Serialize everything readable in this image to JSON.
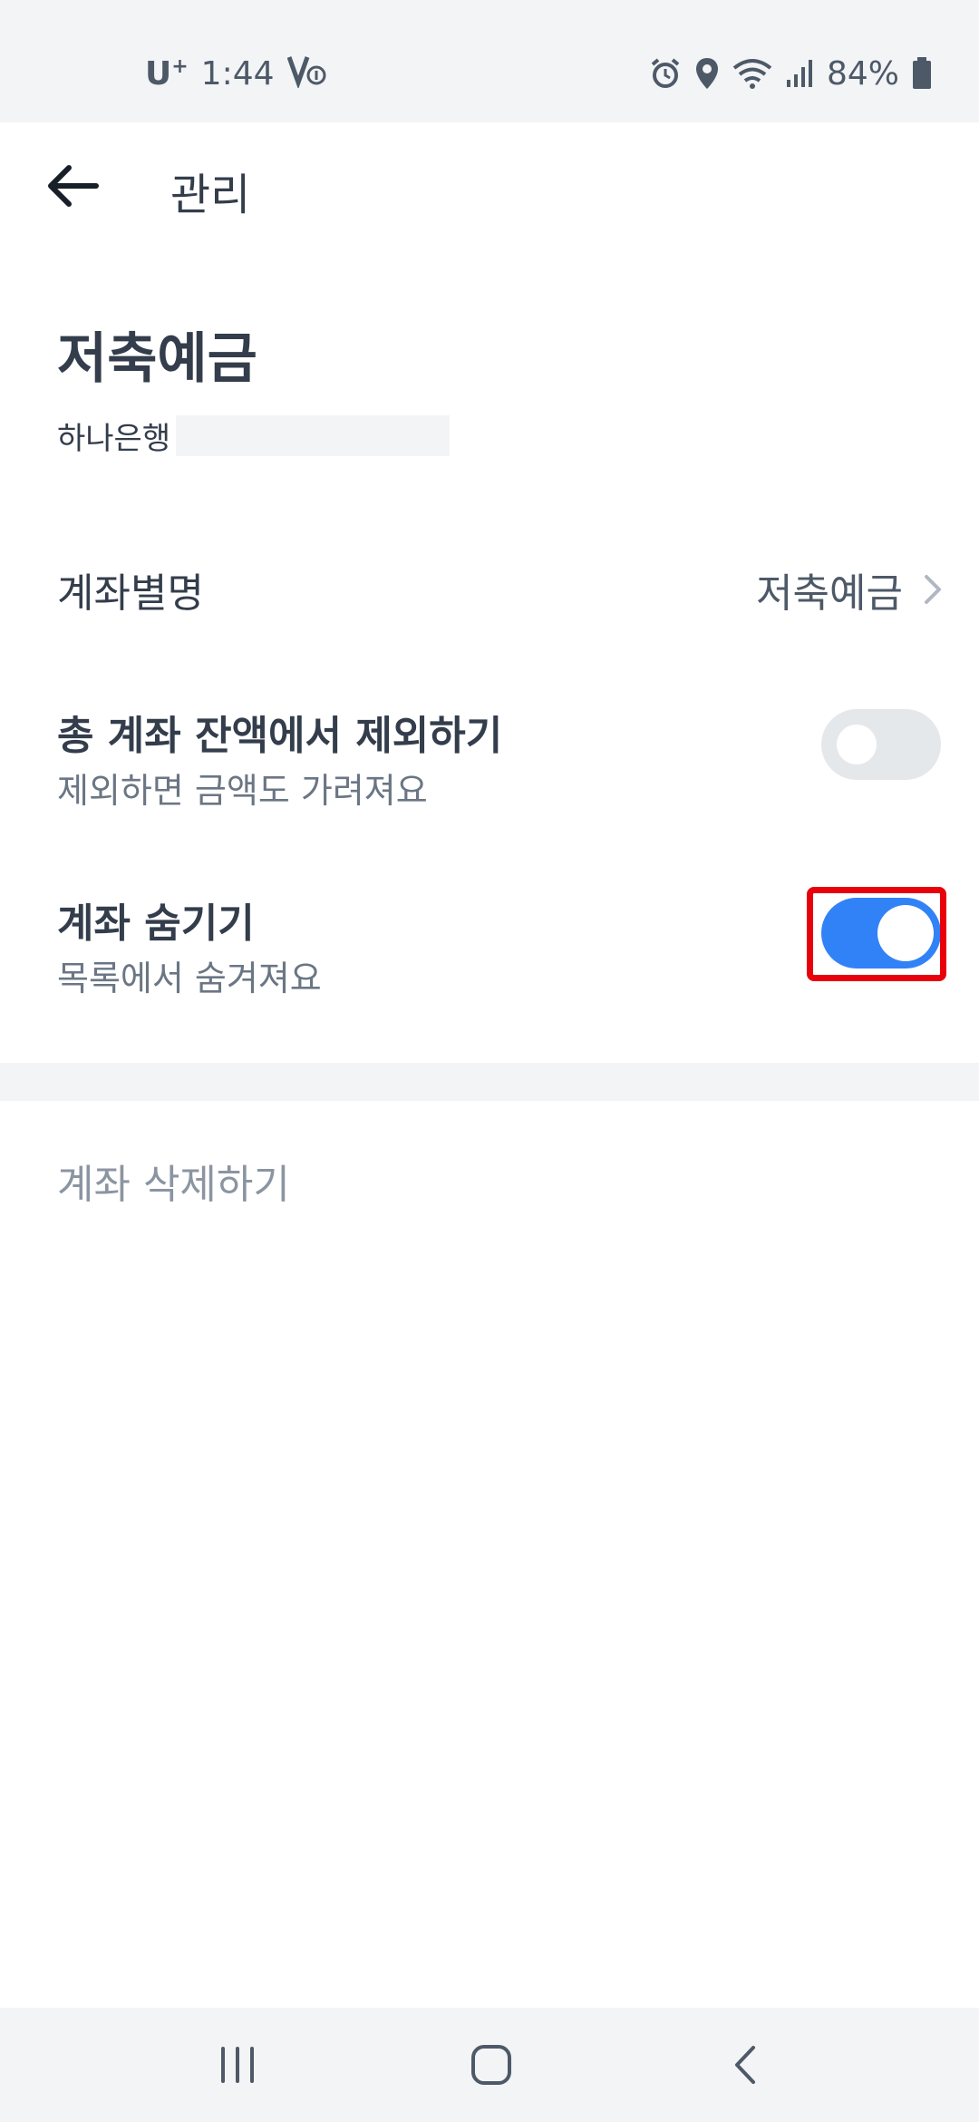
{
  "status_bar": {
    "carrier": "U",
    "carrier_plus": "+",
    "time": "1:44",
    "battery": "84%"
  },
  "app_bar": {
    "title": "관리"
  },
  "account": {
    "name": "저축예금",
    "bank": "하나은행"
  },
  "nickname": {
    "label": "계좌별명",
    "value": "저축예금"
  },
  "exclude_balance": {
    "title": "총 계좌 잔액에서 제외하기",
    "subtitle": "제외하면 금액도 가려져요",
    "enabled": false
  },
  "hide_account": {
    "title": "계좌 숨기기",
    "subtitle": "목록에서 숨겨져요",
    "enabled": true
  },
  "delete": {
    "label": "계좌 삭제하기"
  },
  "colors": {
    "accent": "#3182f6",
    "highlight": "#e8000b",
    "toggle_off": "#e5e8eb"
  }
}
